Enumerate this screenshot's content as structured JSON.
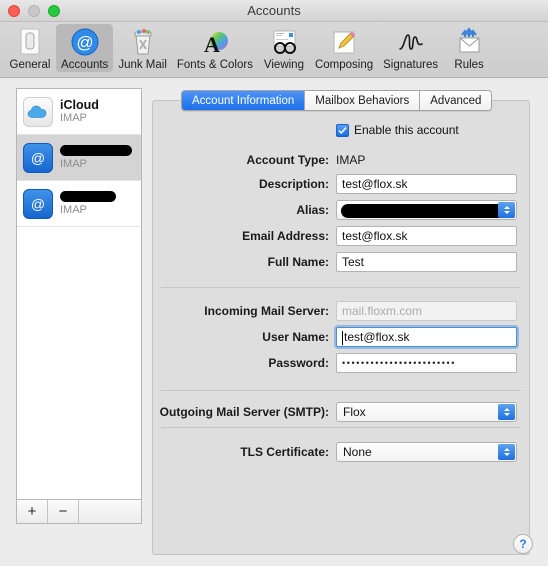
{
  "window": {
    "title": "Accounts",
    "traffic": {
      "close": "close-button",
      "minimize": "minimize-button",
      "zoom": "zoom-button"
    }
  },
  "toolbar": {
    "items": [
      {
        "label": "General",
        "icon": "general-icon"
      },
      {
        "label": "Accounts",
        "icon": "accounts-at-icon",
        "selected": true
      },
      {
        "label": "Junk Mail",
        "icon": "junk-mail-trash-icon"
      },
      {
        "label": "Fonts & Colors",
        "icon": "fonts-colors-icon"
      },
      {
        "label": "Viewing",
        "icon": "viewing-glasses-icon"
      },
      {
        "label": "Composing",
        "icon": "composing-pencil-icon"
      },
      {
        "label": "Signatures",
        "icon": "signatures-icon"
      },
      {
        "label": "Rules",
        "icon": "rules-envelope-icon"
      }
    ]
  },
  "sidebar": {
    "accounts": [
      {
        "name": "iCloud",
        "type": "IMAP",
        "icon": "icloud-icon",
        "redacted": false,
        "selected": false
      },
      {
        "name": "",
        "type": "IMAP",
        "icon": "at-icon",
        "redacted": true,
        "selected": true,
        "redact_width": 72
      },
      {
        "name": "",
        "type": "IMAP",
        "icon": "at-icon",
        "redacted": true,
        "selected": false,
        "redact_width": 56
      }
    ],
    "add_label": "+",
    "remove_label": "−"
  },
  "panel": {
    "tabs": [
      {
        "label": "Account Information",
        "active": true
      },
      {
        "label": "Mailbox Behaviors",
        "active": false
      },
      {
        "label": "Advanced",
        "active": false
      }
    ],
    "enable_account": {
      "label": "Enable this account",
      "checked": true
    },
    "fields": {
      "account_type": {
        "label": "Account Type:",
        "value": "IMAP"
      },
      "description": {
        "label": "Description:",
        "value": "test@flox.sk"
      },
      "alias": {
        "label": "Alias:",
        "value": "",
        "redacted": true
      },
      "email_address": {
        "label": "Email Address:",
        "value": "test@flox.sk"
      },
      "full_name": {
        "label": "Full Name:",
        "value": "Test"
      },
      "incoming_mail_server": {
        "label": "Incoming Mail Server:",
        "value": "",
        "placeholder": "mail.floxm.com",
        "disabled": true
      },
      "user_name": {
        "label": "User Name:",
        "value": "test@flox.sk",
        "focused": true
      },
      "password": {
        "label": "Password:",
        "value": "••••••••••••••••••••••••"
      },
      "outgoing_smtp": {
        "label": "Outgoing Mail Server (SMTP):",
        "value": "Flox"
      },
      "tls_certificate": {
        "label": "TLS Certificate:",
        "value": "None"
      }
    }
  },
  "help": {
    "label": "?"
  },
  "colors": {
    "accent_blue": "#1c6fe8",
    "window_bg": "#ececec",
    "panel_bg": "#dedede",
    "placeholder_gray": "#ababab"
  }
}
